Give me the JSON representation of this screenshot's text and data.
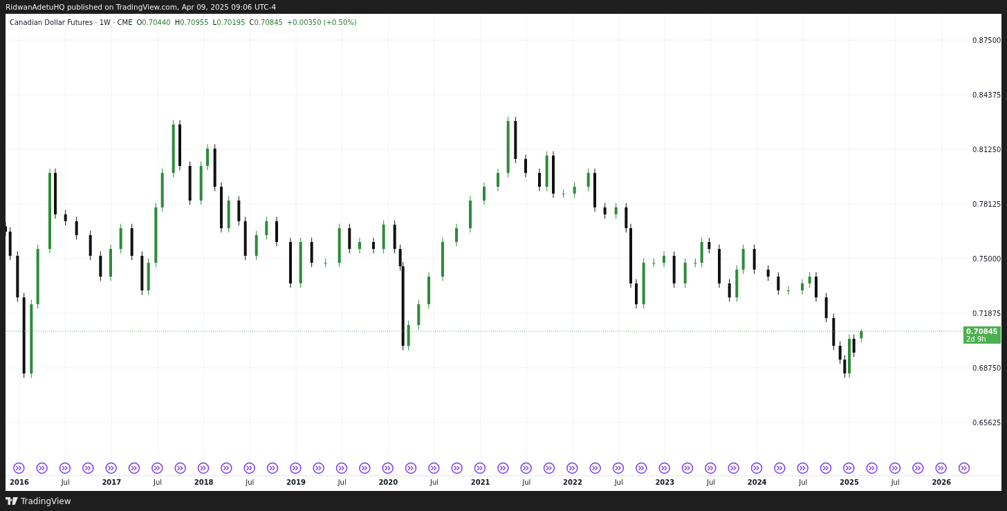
{
  "title_bar": {
    "text": "RidwanAdetuHQ published on TradingView.com, Apr 09, 2025 09:06 UTC-4"
  },
  "legend": {
    "symbol": "Canadian Dollar Futures · 1W · CME",
    "ohlc": [
      {
        "label": "O",
        "value": "0.70440"
      },
      {
        "label": "H",
        "value": "0.70955"
      },
      {
        "label": "L",
        "value": "0.70195"
      },
      {
        "label": "C",
        "value": "0.70845"
      }
    ],
    "change": "+0.00350 (+0.50%)"
  },
  "chart": {
    "chart_data": {
      "type": "candlestick",
      "grid": true,
      "x": [
        2015.85,
        2015.9,
        2015.98,
        2016.05,
        2016.13,
        2016.2,
        2016.33,
        2016.39,
        2016.5,
        2016.62,
        2016.77,
        2016.88,
        2016.99,
        2017.1,
        2017.22,
        2017.33,
        2017.4,
        2017.48,
        2017.55,
        2017.67,
        2017.74,
        2017.85,
        2017.97,
        2018.04,
        2018.12,
        2018.19,
        2018.27,
        2018.38,
        2018.45,
        2018.57,
        2018.68,
        2018.79,
        2018.94,
        2019.05,
        2019.17,
        2019.32,
        2019.47,
        2019.58,
        2019.69,
        2019.84,
        2019.95,
        2020.07,
        2020.13,
        2020.16,
        2020.22,
        2020.33,
        2020.44,
        2020.59,
        2020.74,
        2020.89,
        2021.04,
        2021.19,
        2021.3,
        2021.38,
        2021.49,
        2021.64,
        2021.72,
        2021.79,
        2021.9,
        2022.02,
        2022.17,
        2022.24,
        2022.35,
        2022.47,
        2022.58,
        2022.63,
        2022.69,
        2022.77,
        2022.88,
        2022.99,
        2023.1,
        2023.22,
        2023.33,
        2023.4,
        2023.48,
        2023.59,
        2023.7,
        2023.78,
        2023.85,
        2023.97,
        2024.12,
        2024.23,
        2024.34,
        2024.49,
        2024.57,
        2024.64,
        2024.75,
        2024.83,
        2024.9,
        2024.95,
        2025.0,
        2025.05,
        2025.13
      ],
      "ohlc": [
        [
          0.7684,
          0.7709,
          0.7629,
          0.7654
        ],
        [
          0.7654,
          0.7679,
          0.7491,
          0.7516
        ],
        [
          0.7516,
          0.7541,
          0.7253,
          0.7278
        ],
        [
          0.7278,
          0.7303,
          0.6818,
          0.6843
        ],
        [
          0.6843,
          0.7264,
          0.6818,
          0.7239
        ],
        [
          0.7239,
          0.758,
          0.7214,
          0.7555
        ],
        [
          0.7555,
          0.8015,
          0.753,
          0.799
        ],
        [
          0.799,
          0.8015,
          0.7728,
          0.7753
        ],
        [
          0.7753,
          0.7778,
          0.7689,
          0.7714
        ],
        [
          0.7714,
          0.7739,
          0.7609,
          0.7634
        ],
        [
          0.7634,
          0.7659,
          0.7491,
          0.7516
        ],
        [
          0.7516,
          0.7541,
          0.7372,
          0.7397
        ],
        [
          0.7397,
          0.758,
          0.7372,
          0.7555
        ],
        [
          0.7555,
          0.7699,
          0.753,
          0.7674
        ],
        [
          0.7674,
          0.7699,
          0.7491,
          0.7516
        ],
        [
          0.7516,
          0.7541,
          0.7293,
          0.7318
        ],
        [
          0.7318,
          0.7501,
          0.7293,
          0.7476
        ],
        [
          0.7476,
          0.7818,
          0.7451,
          0.7793
        ],
        [
          0.7793,
          0.8015,
          0.7768,
          0.799
        ],
        [
          0.799,
          0.8292,
          0.7965,
          0.8267
        ],
        [
          0.8267,
          0.8292,
          0.8005,
          0.803
        ],
        [
          0.803,
          0.8055,
          0.7807,
          0.7832
        ],
        [
          0.7832,
          0.8055,
          0.7807,
          0.803
        ],
        [
          0.803,
          0.8154,
          0.8005,
          0.8129
        ],
        [
          0.8129,
          0.8154,
          0.7886,
          0.7911
        ],
        [
          0.7911,
          0.7936,
          0.7649,
          0.7674
        ],
        [
          0.7674,
          0.7857,
          0.7649,
          0.7832
        ],
        [
          0.7832,
          0.7857,
          0.7689,
          0.7714
        ],
        [
          0.7714,
          0.7739,
          0.7491,
          0.7516
        ],
        [
          0.7516,
          0.7659,
          0.7491,
          0.7634
        ],
        [
          0.7634,
          0.7739,
          0.7609,
          0.7714
        ],
        [
          0.7714,
          0.7739,
          0.757,
          0.7595
        ],
        [
          0.7595,
          0.762,
          0.7333,
          0.7358
        ],
        [
          0.7358,
          0.762,
          0.7333,
          0.7595
        ],
        [
          0.7595,
          0.762,
          0.7451,
          0.7476
        ],
        [
          0.7476,
          0.7501,
          0.7451,
          0.7476
        ],
        [
          0.7476,
          0.7699,
          0.7451,
          0.7674
        ],
        [
          0.7674,
          0.7699,
          0.753,
          0.7555
        ],
        [
          0.7555,
          0.762,
          0.753,
          0.7595
        ],
        [
          0.7595,
          0.762,
          0.753,
          0.7555
        ],
        [
          0.7555,
          0.7719,
          0.753,
          0.7694
        ],
        [
          0.7694,
          0.7719,
          0.753,
          0.7555
        ],
        [
          0.7555,
          0.758,
          0.7431,
          0.7456
        ],
        [
          0.7456,
          0.7481,
          0.6976,
          0.7001
        ],
        [
          0.7001,
          0.7145,
          0.6976,
          0.712
        ],
        [
          0.712,
          0.7264,
          0.7095,
          0.7239
        ],
        [
          0.7239,
          0.7422,
          0.7214,
          0.7397
        ],
        [
          0.7397,
          0.762,
          0.7372,
          0.7595
        ],
        [
          0.7595,
          0.7699,
          0.757,
          0.7674
        ],
        [
          0.7674,
          0.7857,
          0.7649,
          0.7832
        ],
        [
          0.7832,
          0.7936,
          0.7807,
          0.7911
        ],
        [
          0.7911,
          0.8015,
          0.7886,
          0.799
        ],
        [
          0.799,
          0.8312,
          0.7965,
          0.8287
        ],
        [
          0.8287,
          0.8312,
          0.8045,
          0.807
        ],
        [
          0.807,
          0.8095,
          0.7965,
          0.799
        ],
        [
          0.799,
          0.8015,
          0.7886,
          0.7911
        ],
        [
          0.7911,
          0.8114,
          0.7886,
          0.8089
        ],
        [
          0.8089,
          0.8114,
          0.7847,
          0.7872
        ],
        [
          0.7872,
          0.7897,
          0.7847,
          0.7872
        ],
        [
          0.7872,
          0.7936,
          0.7847,
          0.7911
        ],
        [
          0.7911,
          0.8015,
          0.7886,
          0.799
        ],
        [
          0.799,
          0.8015,
          0.7768,
          0.7793
        ],
        [
          0.7793,
          0.7818,
          0.7728,
          0.7753
        ],
        [
          0.7753,
          0.7818,
          0.7728,
          0.7793
        ],
        [
          0.7793,
          0.7818,
          0.7649,
          0.7674
        ],
        [
          0.7674,
          0.7699,
          0.7333,
          0.7358
        ],
        [
          0.7358,
          0.7383,
          0.7214,
          0.7239
        ],
        [
          0.7239,
          0.7501,
          0.7214,
          0.7476
        ],
        [
          0.7476,
          0.7501,
          0.7451,
          0.7476
        ],
        [
          0.7476,
          0.7541,
          0.7451,
          0.7516
        ],
        [
          0.7516,
          0.7541,
          0.7333,
          0.7358
        ],
        [
          0.7358,
          0.7501,
          0.7333,
          0.7476
        ],
        [
          0.7476,
          0.7501,
          0.7451,
          0.7476
        ],
        [
          0.7476,
          0.762,
          0.7451,
          0.7595
        ],
        [
          0.7595,
          0.762,
          0.753,
          0.7555
        ],
        [
          0.7555,
          0.758,
          0.7333,
          0.7358
        ],
        [
          0.7358,
          0.7383,
          0.7253,
          0.7278
        ],
        [
          0.7278,
          0.7462,
          0.7253,
          0.7437
        ],
        [
          0.7437,
          0.758,
          0.7412,
          0.7555
        ],
        [
          0.7555,
          0.758,
          0.7412,
          0.7437
        ],
        [
          0.7437,
          0.7462,
          0.7372,
          0.7397
        ],
        [
          0.7397,
          0.7422,
          0.7293,
          0.7318
        ],
        [
          0.7318,
          0.7343,
          0.7293,
          0.7318
        ],
        [
          0.7318,
          0.7383,
          0.7293,
          0.7358
        ],
        [
          0.7358,
          0.7422,
          0.7333,
          0.7397
        ],
        [
          0.7397,
          0.7422,
          0.7253,
          0.7278
        ],
        [
          0.7278,
          0.7303,
          0.7135,
          0.716
        ],
        [
          0.716,
          0.7185,
          0.6976,
          0.7001
        ],
        [
          0.7001,
          0.7026,
          0.6897,
          0.6922
        ],
        [
          0.6922,
          0.6947,
          0.6818,
          0.6843
        ],
        [
          0.6843,
          0.7066,
          0.6818,
          0.7041
        ],
        [
          0.7041,
          0.7066,
          0.6937,
          0.6962
        ],
        [
          0.7044,
          0.7096,
          0.702,
          0.7085
        ]
      ],
      "xlim": [
        2015.85,
        2026.65
      ],
      "ylim": [
        0.6258,
        0.89
      ],
      "xticks": [
        {
          "value": 2016,
          "label": "2016"
        },
        {
          "value": 2016.5,
          "label": "Jul"
        },
        {
          "value": 2017,
          "label": "2017"
        },
        {
          "value": 2017.5,
          "label": "Jul"
        },
        {
          "value": 2018,
          "label": "2018"
        },
        {
          "value": 2018.5,
          "label": "Jul"
        },
        {
          "value": 2019,
          "label": "2019"
        },
        {
          "value": 2019.5,
          "label": "Jul"
        },
        {
          "value": 2020,
          "label": "2020"
        },
        {
          "value": 2020.5,
          "label": "Jul"
        },
        {
          "value": 2021,
          "label": "2021"
        },
        {
          "value": 2021.5,
          "label": "Jul"
        },
        {
          "value": 2022,
          "label": "2022"
        },
        {
          "value": 2022.5,
          "label": "Jul"
        },
        {
          "value": 2023,
          "label": "2023"
        },
        {
          "value": 2023.5,
          "label": "Jul"
        },
        {
          "value": 2024,
          "label": "2024"
        },
        {
          "value": 2024.5,
          "label": "Jul"
        },
        {
          "value": 2025,
          "label": "2025"
        },
        {
          "value": 2025.5,
          "label": "Jul"
        },
        {
          "value": 2026,
          "label": "2026"
        }
      ],
      "yticks": [
        {
          "value": 0.65625,
          "label": "0.65625"
        },
        {
          "value": 0.6875,
          "label": "0.68750"
        },
        {
          "value": 0.71875,
          "label": "0.71875"
        },
        {
          "value": 0.75,
          "label": "0.75000"
        },
        {
          "value": 0.78125,
          "label": "0.78125"
        },
        {
          "value": 0.8125,
          "label": "0.81250"
        },
        {
          "value": 0.84375,
          "label": "0.84375"
        },
        {
          "value": 0.875,
          "label": "0.87500"
        }
      ],
      "ref_lines": [
        {
          "axis": "y",
          "value": 0.70845,
          "label": "0.70845",
          "color": "#4caf50"
        }
      ]
    },
    "last_price": {
      "countdown": "2d 9h"
    }
  },
  "footer": {
    "brand": "TradingView"
  }
}
